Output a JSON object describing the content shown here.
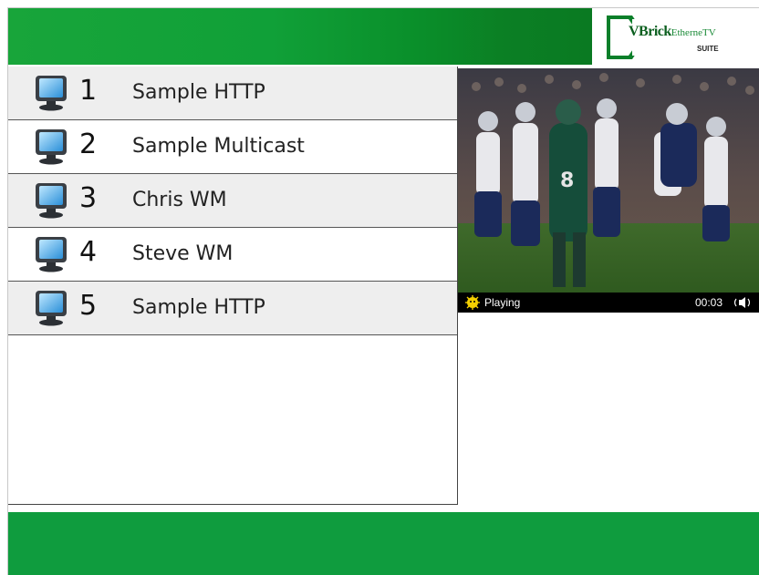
{
  "app": {
    "logo": {
      "brand_main": "VBrick",
      "brand_product": "EtherneTV",
      "brand_sub": "SUITE"
    },
    "colors": {
      "header_green": "#10a038",
      "footer_green": "#0f9c3e",
      "row_alt": "#eeeeee"
    }
  },
  "channels": [
    {
      "number": "1",
      "name": "Sample HTTP",
      "icon": "monitor-icon"
    },
    {
      "number": "2",
      "name": "Sample Multicast",
      "icon": "monitor-icon"
    },
    {
      "number": "3",
      "name": "Chris WM",
      "icon": "monitor-icon"
    },
    {
      "number": "4",
      "name": "Steve WM",
      "icon": "monitor-icon"
    },
    {
      "number": "5",
      "name": "Sample HTTP",
      "icon": "monitor-icon"
    }
  ],
  "player": {
    "status": "Playing",
    "time": "00:03",
    "status_icon": "playing-icon",
    "volume_icon": "speaker-icon"
  }
}
